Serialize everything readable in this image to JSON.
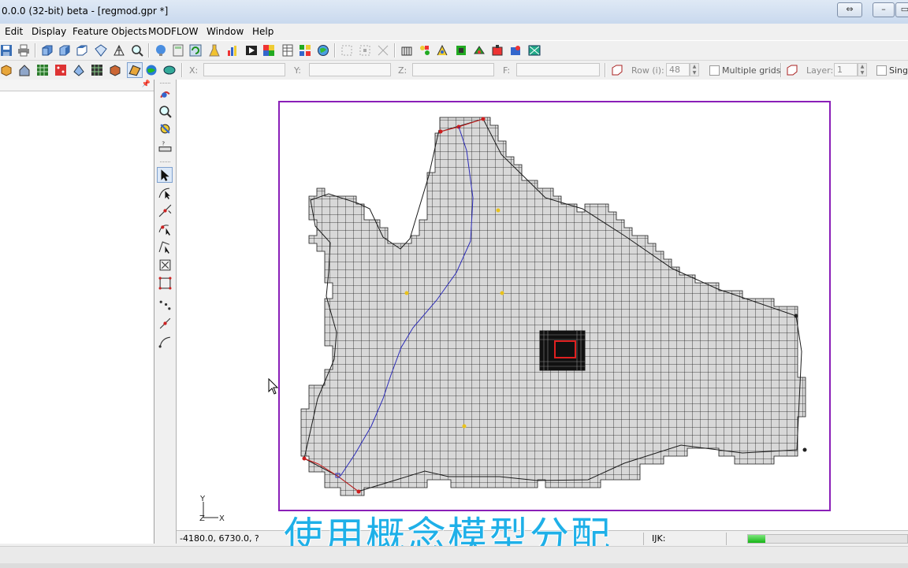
{
  "window": {
    "title": "0.0.0 (32-bit) beta - [regmod.gpr *]",
    "restore_glyph": "⇔",
    "min_glyph": "▭",
    "max_glyph": "▭"
  },
  "menu": [
    "Edit",
    "Display",
    "Feature Objects",
    "MODFLOW",
    "Window",
    "Help"
  ],
  "coords_bar": {
    "x_label": "X:",
    "y_label": "Y:",
    "z_label": "Z:",
    "f_label": "F:",
    "row_label": "Row (i):",
    "row_value": "48",
    "multiple_grids_label": "Multiple grids",
    "layer_label": "Layer:",
    "layer_value": "1",
    "single_label": "Single"
  },
  "axis": {
    "y": "Y",
    "z": "Z",
    "x": "X"
  },
  "status": {
    "coords": "-4180.0, 6730.0, ?",
    "ijk": "IJK:",
    "progress": 0.11
  },
  "caption": "使用概念模型分配",
  "colors": {
    "frame": "#8a1fb8",
    "grid_fill": "#d8d8d8",
    "river": "#2b2bb8",
    "boundary_red": "#cc1e1e",
    "point_yellow": "#e9c21b",
    "caption": "#1fb0e8"
  },
  "icons": {
    "toolbar1": [
      "save-icon",
      "print-icon",
      "view-front-icon",
      "view-side-icon",
      "view-top-icon",
      "view-oblique-icon",
      "mesh-icon",
      "pan-icon",
      "zoom-icon",
      "info-icon",
      "refresh-icon",
      "calculator-icon",
      "chart-icon",
      "film-icon",
      "color-ramp-icon",
      "table-icon",
      "add-layer-icon",
      "globe-icon",
      "select-group-icon",
      "lock-icon",
      "unlock-icon",
      "modflow-icon",
      "run-icon",
      "well-icon",
      "drain-icon",
      "river-icon",
      "flow-icon",
      "export-icon"
    ],
    "toolbar2": [
      "box-icon",
      "building-icon",
      "grid-icon",
      "points-icon",
      "scatter-icon",
      "ugrid-icon",
      "mesh-3d-icon",
      "map-icon",
      "globe-color-icon",
      "gis-icon"
    ],
    "vtools": [
      "rotate-icon",
      "zoom-window-icon",
      "frame-icon",
      "measure-icon",
      "select-arrow-icon",
      "select-arc-icon",
      "create-node-icon",
      "create-vertex-icon",
      "create-arc-icon",
      "select-polygon-icon",
      "build-polygon-icon",
      "points-tool-icon",
      "line-tool-icon",
      "spline-tool-icon"
    ]
  }
}
